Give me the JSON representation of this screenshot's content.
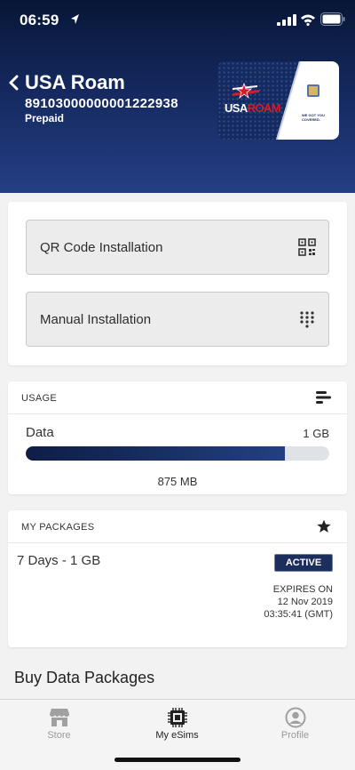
{
  "status_bar": {
    "time": "06:59"
  },
  "esim": {
    "name": "USA Roam",
    "iccid": "89103000000001222938",
    "plan_type": "Prepaid"
  },
  "card_image": {
    "logo_left": "USA",
    "logo_right": "ROAM",
    "tagline": "WE GOT YOU COVERED."
  },
  "install": {
    "qr_label": "QR Code Installation",
    "manual_label": "Manual Installation"
  },
  "usage": {
    "title": "USAGE",
    "label": "Data",
    "total": "1 GB",
    "used": "875 MB",
    "fraction_used": 0.855
  },
  "packages": {
    "title": "MY PACKAGES",
    "items": [
      {
        "name": "7 Days - 1 GB",
        "status": "ACTIVE",
        "expires_label": "EXPIRES ON",
        "expires_date": "12 Nov 2019",
        "expires_time": "03:35:41 (GMT)"
      }
    ]
  },
  "buy_title": "Buy Data Packages",
  "tabs": [
    {
      "label": "Store",
      "icon": "store-icon"
    },
    {
      "label": "My eSims",
      "icon": "chip-icon"
    },
    {
      "label": "Profile",
      "icon": "profile-icon"
    }
  ],
  "colors": {
    "header_top": "#071636",
    "header_bottom": "#253f84",
    "accent_navy": "#1b2e5c",
    "brand_red": "#d31d2b"
  }
}
